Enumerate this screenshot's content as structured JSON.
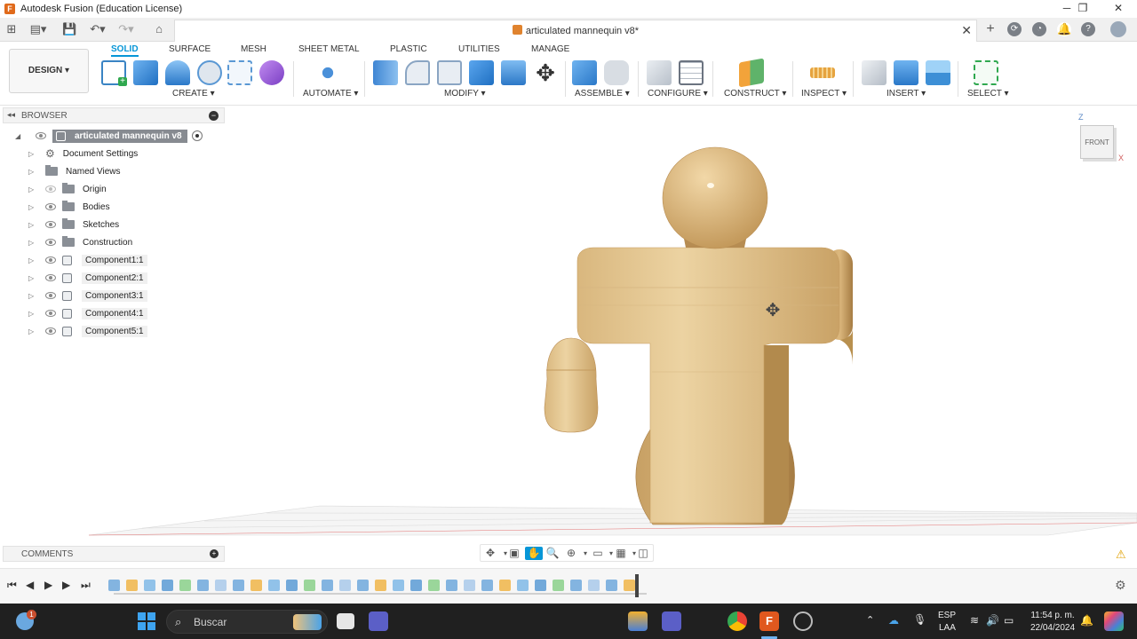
{
  "window": {
    "title": "Autodesk Fusion (Education License)",
    "minimize": "─",
    "restore": "❐",
    "close": "✕"
  },
  "document": {
    "tab_title": "articulated mannequin v8*",
    "close": "✕"
  },
  "tabbar_right": {
    "add": "+"
  },
  "ribbon": {
    "workspace_button": "DESIGN ▾",
    "tabs": [
      "SOLID",
      "SURFACE",
      "MESH",
      "SHEET METAL",
      "PLASTIC",
      "UTILITIES",
      "MANAGE"
    ],
    "active_tab": "SOLID",
    "groups": [
      "CREATE ▾",
      "AUTOMATE ▾",
      "MODIFY ▾",
      "ASSEMBLE ▾",
      "CONFIGURE ▾",
      "CONSTRUCT ▾",
      "INSPECT ▾",
      "INSERT ▾",
      "SELECT ▾"
    ]
  },
  "browser": {
    "header": "BROWSER",
    "collapse": "◂◂",
    "minus": "−",
    "root": "articulated mannequin v8",
    "items": [
      {
        "label": "Document Settings",
        "icon": "gear-icon"
      },
      {
        "label": "Named Views",
        "icon": "folder-icon"
      },
      {
        "label": "Origin",
        "icon": "folder-icon"
      },
      {
        "label": "Bodies",
        "icon": "folder-icon"
      },
      {
        "label": "Sketches",
        "icon": "folder-icon"
      },
      {
        "label": "Construction",
        "icon": "folder-icon"
      },
      {
        "label": "Component1:1",
        "icon": "component-icon"
      },
      {
        "label": "Component2:1",
        "icon": "component-icon"
      },
      {
        "label": "Component3:1",
        "icon": "component-icon"
      },
      {
        "label": "Component4:1",
        "icon": "component-icon"
      },
      {
        "label": "Component5:1",
        "icon": "component-icon"
      }
    ]
  },
  "viewcube": {
    "face": "FRONT",
    "z": "Z",
    "x": "X"
  },
  "comments": {
    "label": "COMMENTS"
  },
  "taskbar": {
    "search_placeholder": "Buscar",
    "language": "ESP",
    "layout": "LAA",
    "time": "11:54 p. m.",
    "date": "22/04/2024",
    "badge": "1"
  },
  "colors": {
    "accent": "#0696d7",
    "wood": "#e9cb93",
    "taskbar": "#202020"
  }
}
